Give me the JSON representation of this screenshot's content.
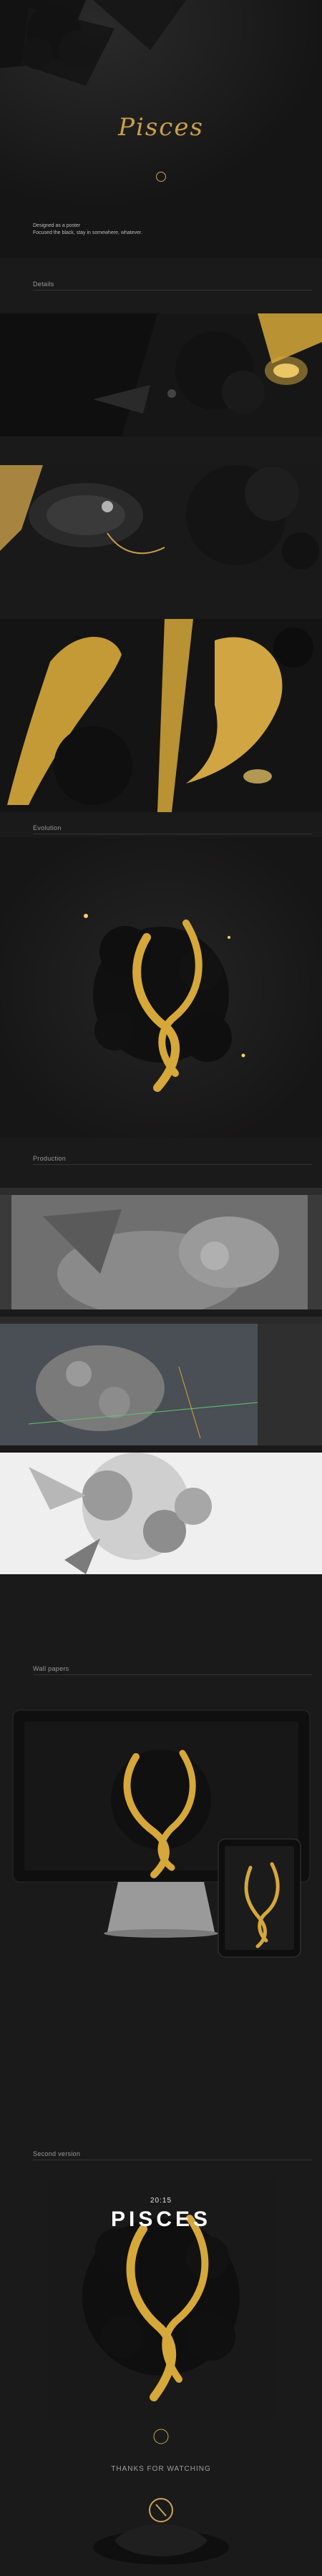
{
  "hero": {
    "title": "Pisces",
    "description_lines": [
      "Designed as a poster",
      "Focused the black, stay in somewhere, whatever."
    ]
  },
  "sections": {
    "details": "Details",
    "evolution": "Evolution",
    "production": "Production",
    "wallpapers": "Wall papers",
    "second_version": "Second version"
  },
  "second_version": {
    "time": "20:15",
    "title": "PISCES"
  },
  "footer": {
    "thanks": "THANKS FOR WATCHING"
  },
  "colors": {
    "background": "#1b1a1a",
    "gold": "#caa04a",
    "accent_gold": "#f2c04a"
  }
}
